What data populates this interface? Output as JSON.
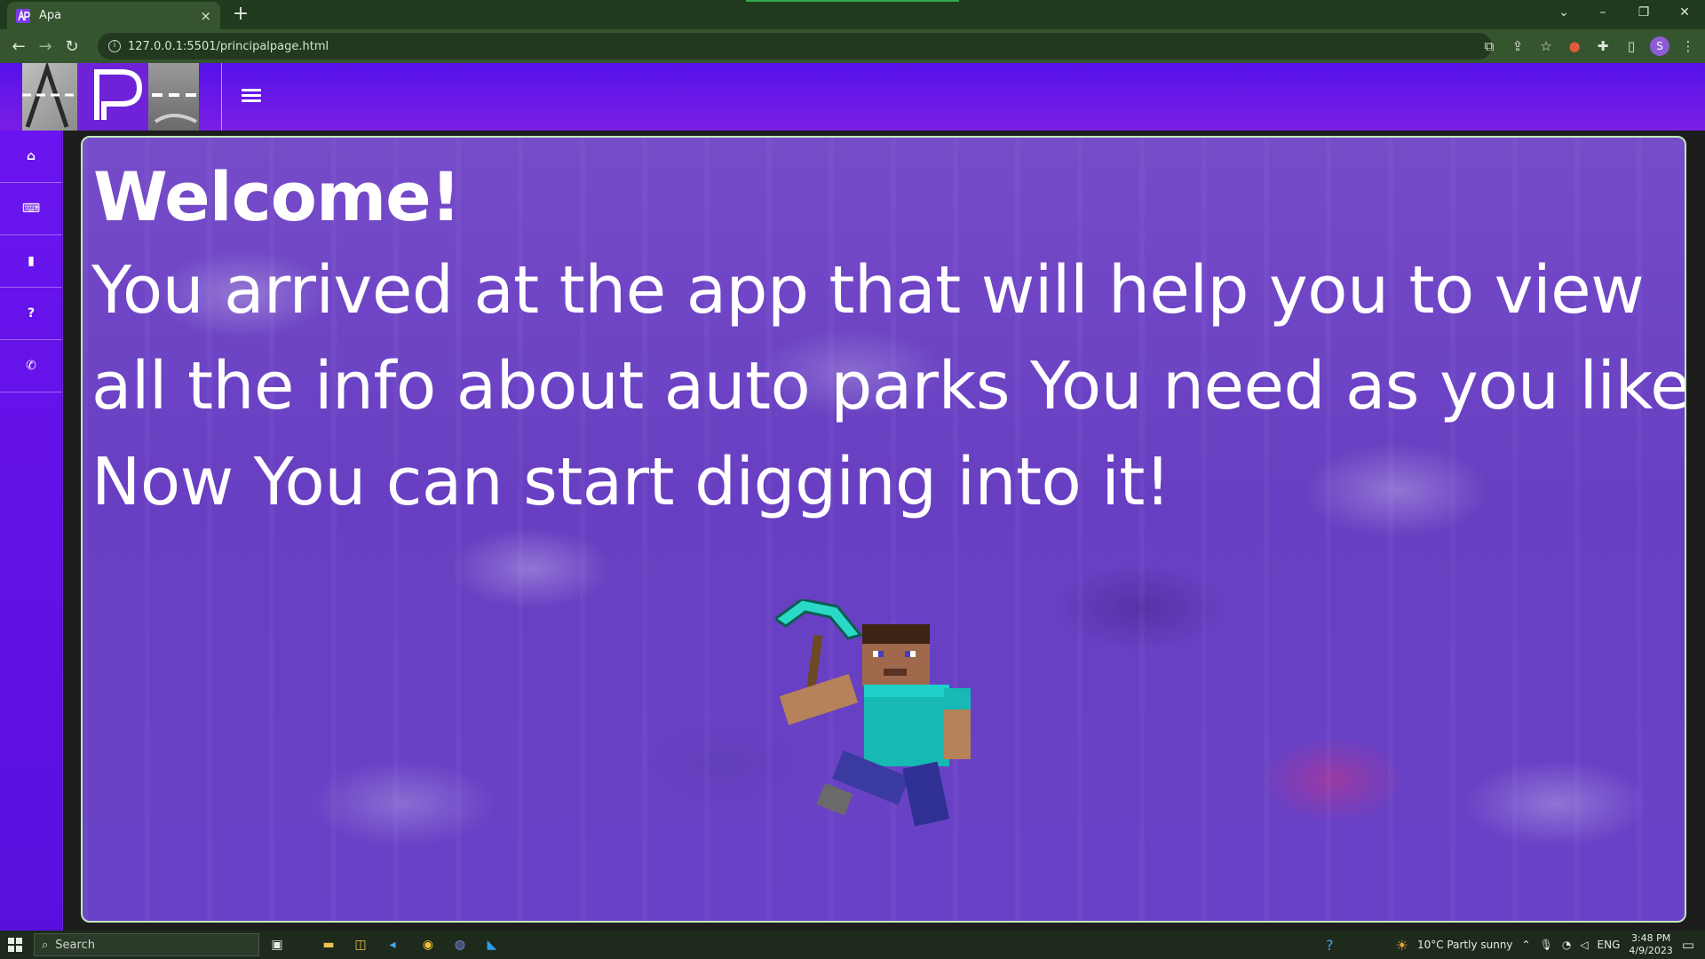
{
  "browser": {
    "tab_title": "Apa",
    "tab_close": "×",
    "new_tab": "+",
    "url": "127.0.0.1:5501/principalpage.html",
    "window_controls": [
      "⌄",
      "–",
      "❐",
      "✕"
    ]
  },
  "page": {
    "welcome": "Welcome!",
    "intro_lines": [
      "You arrived at the app that will help you to view",
      "all the info about auto parks You need as you like",
      "Now You can start digging into it!"
    ],
    "sidebar_icons": [
      "home-icon",
      "keyboard-icon",
      "book-icon",
      "question-icon",
      "phone-icon"
    ],
    "sidebar_glyphs": [
      "⌂",
      "⌨",
      "▮",
      "?",
      "✆"
    ],
    "menu_icon": "menu-icon",
    "colors": {
      "nav_top": "#5511e9",
      "nav_bottom": "#7a1ee4",
      "sidebar": "#6a14ef",
      "panel_border": "#bfe9bd",
      "text": "#ffffff"
    }
  },
  "taskbar": {
    "search_placeholder": "Search",
    "weather": "10°C  Partly sunny",
    "language": "ENG",
    "time": "3:48 PM",
    "date": "4/9/2023"
  }
}
